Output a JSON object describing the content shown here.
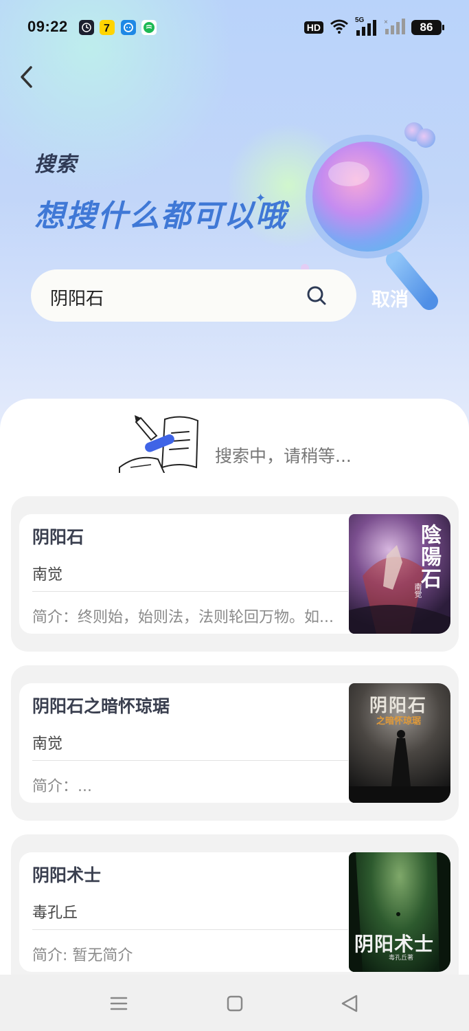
{
  "status_bar": {
    "time": "09:22",
    "network": "HD",
    "signal": "5G",
    "battery": "86"
  },
  "header": {
    "title": "搜索",
    "slogan": "想搜什么都可以哦"
  },
  "search": {
    "query": "阴阳石",
    "cancel_label": "取消"
  },
  "loading": {
    "text": "搜索中，请稍等..."
  },
  "results": [
    {
      "title": "阴阳石",
      "author": "南觉",
      "desc": "简介：终则始，始则法，法则轮回万物。如...",
      "cover_title": "陰陽石",
      "cover_author": "南觉",
      "cover_colors": [
        "#2a1f3a",
        "#a64a4a",
        "#3c2a55"
      ]
    },
    {
      "title": "阴阳石之暗怀琼琚",
      "author": "南觉",
      "desc": "简介：...",
      "cover_title": "阴阳石",
      "cover_subtitle": "之暗怀琼琚",
      "cover_colors": [
        "#2b2b2b",
        "#5a5550",
        "#1a1a1a"
      ]
    },
    {
      "title": "阴阳术士",
      "author": "毒孔丘",
      "desc": "简介: 暂无简介",
      "cover_title": "阴阳术士",
      "cover_author": "毒孔丘著",
      "cover_colors": [
        "#0f2a18",
        "#2e5a2e",
        "#0a1a0e"
      ]
    }
  ],
  "colors": {
    "accent": "#3f78d6",
    "hero_bg": "#c2d6f9"
  }
}
